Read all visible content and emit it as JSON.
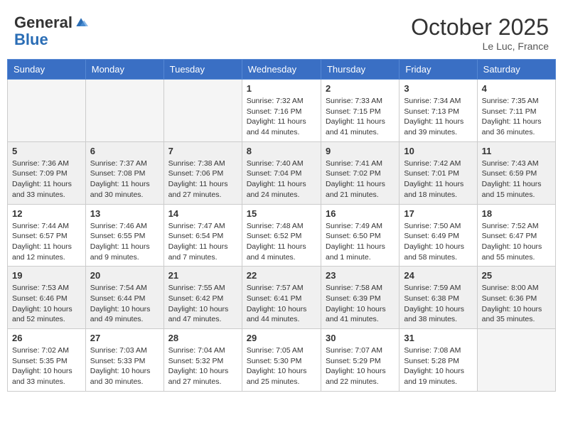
{
  "header": {
    "logo_general": "General",
    "logo_blue": "Blue",
    "month_title": "October 2025",
    "location": "Le Luc, France"
  },
  "weekdays": [
    "Sunday",
    "Monday",
    "Tuesday",
    "Wednesday",
    "Thursday",
    "Friday",
    "Saturday"
  ],
  "weeks": [
    [
      {
        "day": "",
        "info": ""
      },
      {
        "day": "",
        "info": ""
      },
      {
        "day": "",
        "info": ""
      },
      {
        "day": "1",
        "info": "Sunrise: 7:32 AM\nSunset: 7:16 PM\nDaylight: 11 hours and 44 minutes."
      },
      {
        "day": "2",
        "info": "Sunrise: 7:33 AM\nSunset: 7:15 PM\nDaylight: 11 hours and 41 minutes."
      },
      {
        "day": "3",
        "info": "Sunrise: 7:34 AM\nSunset: 7:13 PM\nDaylight: 11 hours and 39 minutes."
      },
      {
        "day": "4",
        "info": "Sunrise: 7:35 AM\nSunset: 7:11 PM\nDaylight: 11 hours and 36 minutes."
      }
    ],
    [
      {
        "day": "5",
        "info": "Sunrise: 7:36 AM\nSunset: 7:09 PM\nDaylight: 11 hours and 33 minutes."
      },
      {
        "day": "6",
        "info": "Sunrise: 7:37 AM\nSunset: 7:08 PM\nDaylight: 11 hours and 30 minutes."
      },
      {
        "day": "7",
        "info": "Sunrise: 7:38 AM\nSunset: 7:06 PM\nDaylight: 11 hours and 27 minutes."
      },
      {
        "day": "8",
        "info": "Sunrise: 7:40 AM\nSunset: 7:04 PM\nDaylight: 11 hours and 24 minutes."
      },
      {
        "day": "9",
        "info": "Sunrise: 7:41 AM\nSunset: 7:02 PM\nDaylight: 11 hours and 21 minutes."
      },
      {
        "day": "10",
        "info": "Sunrise: 7:42 AM\nSunset: 7:01 PM\nDaylight: 11 hours and 18 minutes."
      },
      {
        "day": "11",
        "info": "Sunrise: 7:43 AM\nSunset: 6:59 PM\nDaylight: 11 hours and 15 minutes."
      }
    ],
    [
      {
        "day": "12",
        "info": "Sunrise: 7:44 AM\nSunset: 6:57 PM\nDaylight: 11 hours and 12 minutes."
      },
      {
        "day": "13",
        "info": "Sunrise: 7:46 AM\nSunset: 6:55 PM\nDaylight: 11 hours and 9 minutes."
      },
      {
        "day": "14",
        "info": "Sunrise: 7:47 AM\nSunset: 6:54 PM\nDaylight: 11 hours and 7 minutes."
      },
      {
        "day": "15",
        "info": "Sunrise: 7:48 AM\nSunset: 6:52 PM\nDaylight: 11 hours and 4 minutes."
      },
      {
        "day": "16",
        "info": "Sunrise: 7:49 AM\nSunset: 6:50 PM\nDaylight: 11 hours and 1 minute."
      },
      {
        "day": "17",
        "info": "Sunrise: 7:50 AM\nSunset: 6:49 PM\nDaylight: 10 hours and 58 minutes."
      },
      {
        "day": "18",
        "info": "Sunrise: 7:52 AM\nSunset: 6:47 PM\nDaylight: 10 hours and 55 minutes."
      }
    ],
    [
      {
        "day": "19",
        "info": "Sunrise: 7:53 AM\nSunset: 6:46 PM\nDaylight: 10 hours and 52 minutes."
      },
      {
        "day": "20",
        "info": "Sunrise: 7:54 AM\nSunset: 6:44 PM\nDaylight: 10 hours and 49 minutes."
      },
      {
        "day": "21",
        "info": "Sunrise: 7:55 AM\nSunset: 6:42 PM\nDaylight: 10 hours and 47 minutes."
      },
      {
        "day": "22",
        "info": "Sunrise: 7:57 AM\nSunset: 6:41 PM\nDaylight: 10 hours and 44 minutes."
      },
      {
        "day": "23",
        "info": "Sunrise: 7:58 AM\nSunset: 6:39 PM\nDaylight: 10 hours and 41 minutes."
      },
      {
        "day": "24",
        "info": "Sunrise: 7:59 AM\nSunset: 6:38 PM\nDaylight: 10 hours and 38 minutes."
      },
      {
        "day": "25",
        "info": "Sunrise: 8:00 AM\nSunset: 6:36 PM\nDaylight: 10 hours and 35 minutes."
      }
    ],
    [
      {
        "day": "26",
        "info": "Sunrise: 7:02 AM\nSunset: 5:35 PM\nDaylight: 10 hours and 33 minutes."
      },
      {
        "day": "27",
        "info": "Sunrise: 7:03 AM\nSunset: 5:33 PM\nDaylight: 10 hours and 30 minutes."
      },
      {
        "day": "28",
        "info": "Sunrise: 7:04 AM\nSunset: 5:32 PM\nDaylight: 10 hours and 27 minutes."
      },
      {
        "day": "29",
        "info": "Sunrise: 7:05 AM\nSunset: 5:30 PM\nDaylight: 10 hours and 25 minutes."
      },
      {
        "day": "30",
        "info": "Sunrise: 7:07 AM\nSunset: 5:29 PM\nDaylight: 10 hours and 22 minutes."
      },
      {
        "day": "31",
        "info": "Sunrise: 7:08 AM\nSunset: 5:28 PM\nDaylight: 10 hours and 19 minutes."
      },
      {
        "day": "",
        "info": ""
      }
    ]
  ]
}
